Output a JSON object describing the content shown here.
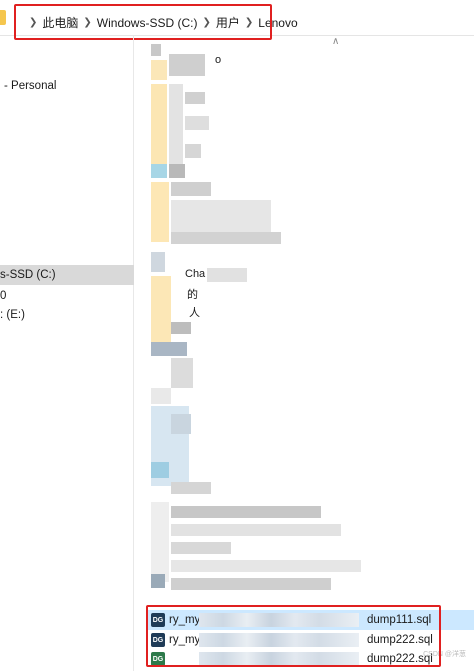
{
  "address_bar": {
    "breadcrumbs": [
      "此电脑",
      "Windows-SSD (C:)",
      "用户",
      "Lenovo"
    ]
  },
  "nav_pane": {
    "items": [
      {
        "label": "- Personal"
      },
      {
        "label": "s-SSD (C:)"
      },
      {
        "label": "0"
      },
      {
        "label": ": (E:)"
      }
    ]
  },
  "content": {
    "partial_texts": [
      "o",
      "Cha",
      "的",
      "人"
    ],
    "files": [
      {
        "icon": "datagrip-sql-icon",
        "name_prefix": "ry_my",
        "name_suffix": "dump111.sql",
        "selected": true
      },
      {
        "icon": "datagrip-sql-icon",
        "name_prefix": "ry_my",
        "name_suffix": "dump222.sql",
        "selected": false
      },
      {
        "icon": "datagrip-sql-icon",
        "name_prefix": "",
        "name_suffix": "dump222.sql",
        "selected": false
      }
    ]
  },
  "watermark": "CSDN @洋葱",
  "colors": {
    "highlight": "#e02020",
    "selection": "#cce8ff",
    "nav_selected": "#d9d9d9",
    "folder": "#f5c64e"
  }
}
